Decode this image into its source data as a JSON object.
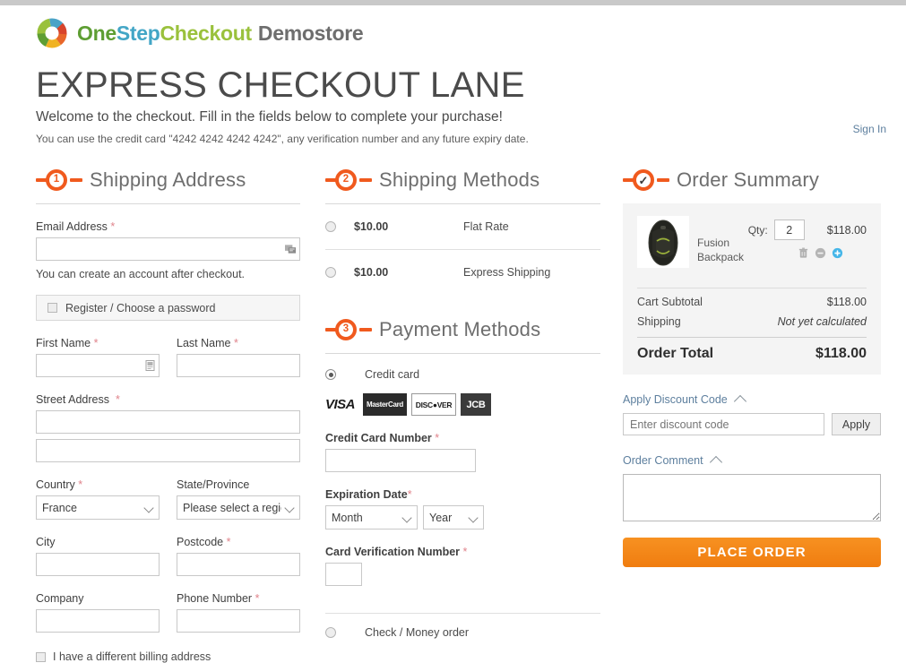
{
  "brand": {
    "logo_icon": "onestepcheckout-ring-logo",
    "name_part1": "One",
    "name_part2": "Step",
    "name_part3": "Checkout",
    "suffix": "Demostore"
  },
  "header": {
    "title": "EXPRESS CHECKOUT LANE",
    "welcome": "Welcome to the checkout. Fill in the fields below to complete your purchase!",
    "credit_card_note": "You can use the credit card \"4242 4242 4242 4242\", any verification number and any future expiry date.",
    "sign_in": "Sign In"
  },
  "shipping_address": {
    "step": "1",
    "title": "Shipping Address",
    "email_label": "Email Address",
    "email_value": "",
    "email_icon": "autofill-contact-icon",
    "account_hint": "You can create an account after checkout.",
    "register_label": "Register / Choose a password",
    "register_checked": false,
    "first_name_label": "First Name",
    "first_name_value": "",
    "first_name_icon": "autofill-card-icon",
    "last_name_label": "Last Name",
    "last_name_value": "",
    "street_label": "Street Address",
    "street_line1": "",
    "street_line2": "",
    "country_label": "Country",
    "country_value": "France",
    "country_options": [
      "France"
    ],
    "state_label": "State/Province",
    "state_value": "Please select a region, state or province.",
    "state_options": [
      "Please select a region, state or province."
    ],
    "city_label": "City",
    "city_value": "",
    "postcode_label": "Postcode",
    "postcode_value": "",
    "company_label": "Company",
    "company_value": "",
    "phone_label": "Phone Number",
    "phone_value": "",
    "billing_label": "I have a different billing address",
    "billing_checked": false,
    "required_mark": "*"
  },
  "shipping_methods": {
    "step": "2",
    "title": "Shipping Methods",
    "options": [
      {
        "price": "$10.00",
        "name": "Flat Rate",
        "selected": false
      },
      {
        "price": "$10.00",
        "name": "Express Shipping",
        "selected": false
      }
    ]
  },
  "payment_methods": {
    "step": "3",
    "title": "Payment Methods",
    "credit_card_label": "Credit card",
    "credit_card_selected": true,
    "accepted_cards": [
      {
        "name": "visa-logo",
        "text": "VISA"
      },
      {
        "name": "mastercard-logo",
        "text": "MasterCard"
      },
      {
        "name": "discover-logo",
        "text": "DISC●VER"
      },
      {
        "name": "jcb-logo",
        "text": "JCB"
      }
    ],
    "card_number_label": "Credit Card Number",
    "card_number_value": "",
    "expiration_label": "Expiration Date",
    "month_value": "Month",
    "month_options": [
      "Month"
    ],
    "year_value": "Year",
    "year_options": [
      "Year"
    ],
    "cvv_label": "Card Verification Number",
    "cvv_value": "",
    "check_money_label": "Check / Money order",
    "check_money_selected": false,
    "required_mark": "*"
  },
  "order_summary": {
    "step_icon": "checkmark",
    "step_glyph": "✓",
    "title": "Order Summary",
    "product": {
      "image_icon": "fusion-backpack-thumbnail",
      "name": "Fusion Backpack",
      "qty_label": "Qty:",
      "qty_value": "2",
      "price": "$118.00",
      "actions": [
        {
          "name": "remove-item-icon",
          "label": "trash"
        },
        {
          "name": "decrease-qty-icon",
          "label": "minus"
        },
        {
          "name": "increase-qty-icon",
          "label": "plus"
        }
      ]
    },
    "totals": [
      {
        "label": "Cart Subtotal",
        "value": "$118.00",
        "italic": false
      },
      {
        "label": "Shipping",
        "value": "Not yet calculated",
        "italic": true
      }
    ],
    "grand_total_label": "Order Total",
    "grand_total_value": "$118.00",
    "discount_link": "Apply Discount Code",
    "discount_placeholder": "Enter discount code",
    "discount_value": "",
    "apply_label": "Apply",
    "comment_link": "Order Comment",
    "comment_value": "",
    "place_order_label": "PLACE ORDER"
  },
  "colors": {
    "accent_orange": "#f05a1e",
    "button_orange": "#f79121",
    "link_blue": "#5d7f9e",
    "summary_bg": "#f4f4f4",
    "required_red": "#e0838b"
  }
}
